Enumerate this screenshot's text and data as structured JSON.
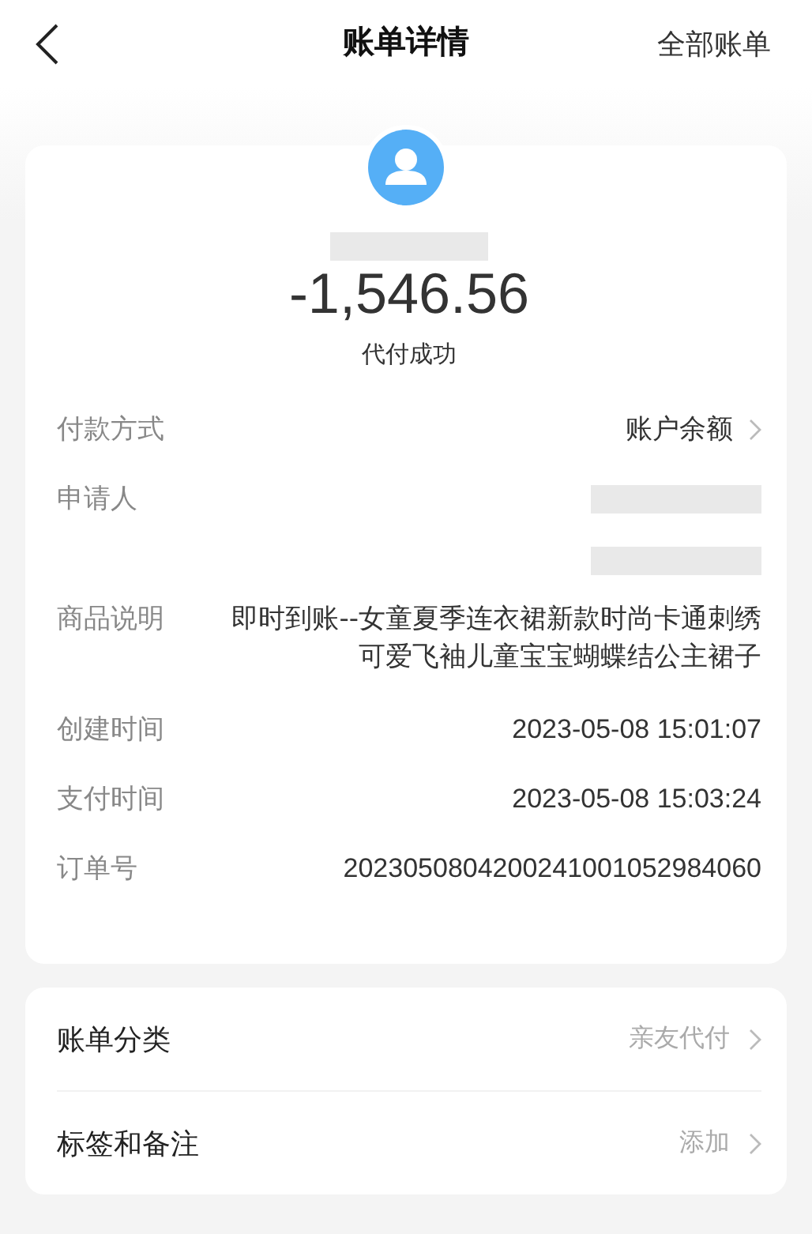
{
  "header": {
    "title": "账单详情",
    "action": "全部账单"
  },
  "summary": {
    "amount": "-1,546.56",
    "status": "代付成功"
  },
  "details": [
    {
      "kind": "link",
      "label": "付款方式",
      "value": "账户余额"
    },
    {
      "kind": "redacted",
      "label": "申请人"
    },
    {
      "kind": "text",
      "label": "商品说明",
      "value": "即时到账--女童夏季连衣裙新款时尚卡通刺绣可爱飞袖儿童宝宝蝴蝶结公主裙子"
    },
    {
      "kind": "text",
      "label": "创建时间",
      "value": "2023-05-08 15:01:07"
    },
    {
      "kind": "text",
      "label": "支付时间",
      "value": "2023-05-08 15:03:24"
    },
    {
      "kind": "text",
      "label": "订单号",
      "value": "2023050804200241001052984060"
    }
  ],
  "settings": [
    {
      "label": "账单分类",
      "value": "亲友代付"
    },
    {
      "label": "标签和备注",
      "value": "添加"
    }
  ]
}
